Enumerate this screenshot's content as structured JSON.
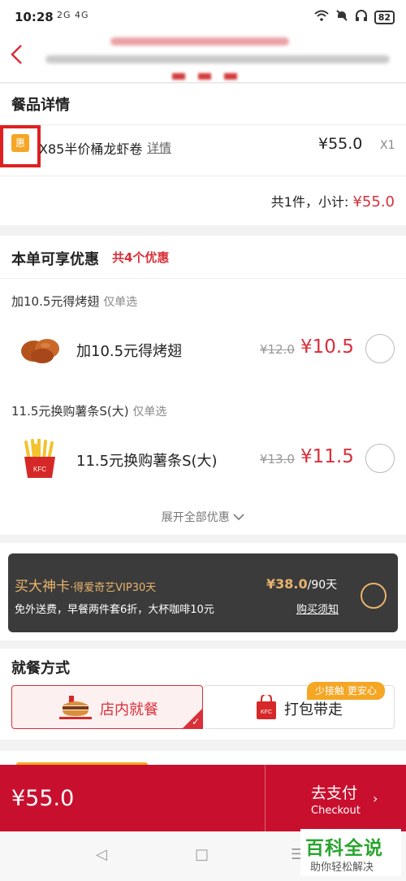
{
  "status": {
    "time": "10:28",
    "network": "2G 4G",
    "battery": "82"
  },
  "order": {
    "section_title": "餐品详情",
    "item_badge": "惠",
    "item_name": "X85半价桶龙虾卷",
    "item_detail_link": "详情",
    "item_price": "¥55.0",
    "item_qty": "X1",
    "subtotal_label": "共1件，小计:",
    "subtotal_value": "¥55.0"
  },
  "promos": {
    "title": "本单可享优惠",
    "count": "共4个优惠",
    "offers": [
      {
        "header": "加10.5元得烤翅",
        "tag": "仅单选",
        "name": "加10.5元得烤翅",
        "old_price": "¥12.0",
        "new_price": "¥10.5",
        "image": "chicken-wings"
      },
      {
        "header": "11.5元换购薯条S(大)",
        "tag": "仅单选",
        "name": "11.5元换购薯条S(大)",
        "old_price": "¥13.0",
        "new_price": "¥11.5",
        "image": "fries"
      }
    ],
    "expand_label": "展开全部优惠"
  },
  "vip": {
    "title": "买大神卡",
    "subtitle": "·得爱奇艺VIP30天",
    "price": "¥38.0",
    "period": "/90天",
    "desc": "免外送费，早餐两件套6折，大杯咖啡10元",
    "link": "购买须知"
  },
  "dining": {
    "title": "就餐方式",
    "dine_in": "店内就餐",
    "takeout": "打包带走",
    "badge": "少接触 更安心",
    "check": "✓"
  },
  "paybar": {
    "total": "¥55.0",
    "pay_cn": "去支付",
    "pay_en": "Checkout",
    "arrow": "›"
  },
  "sysnav": {
    "back": "◁",
    "home": "□",
    "menu": "☰"
  },
  "watermark": {
    "title": "百科全说",
    "subtitle": "助你轻松解决"
  },
  "colors": {
    "brand_red": "#c8102e",
    "accent_red": "#d9303a",
    "gold": "#e8b36b",
    "orange": "#f5a623"
  }
}
